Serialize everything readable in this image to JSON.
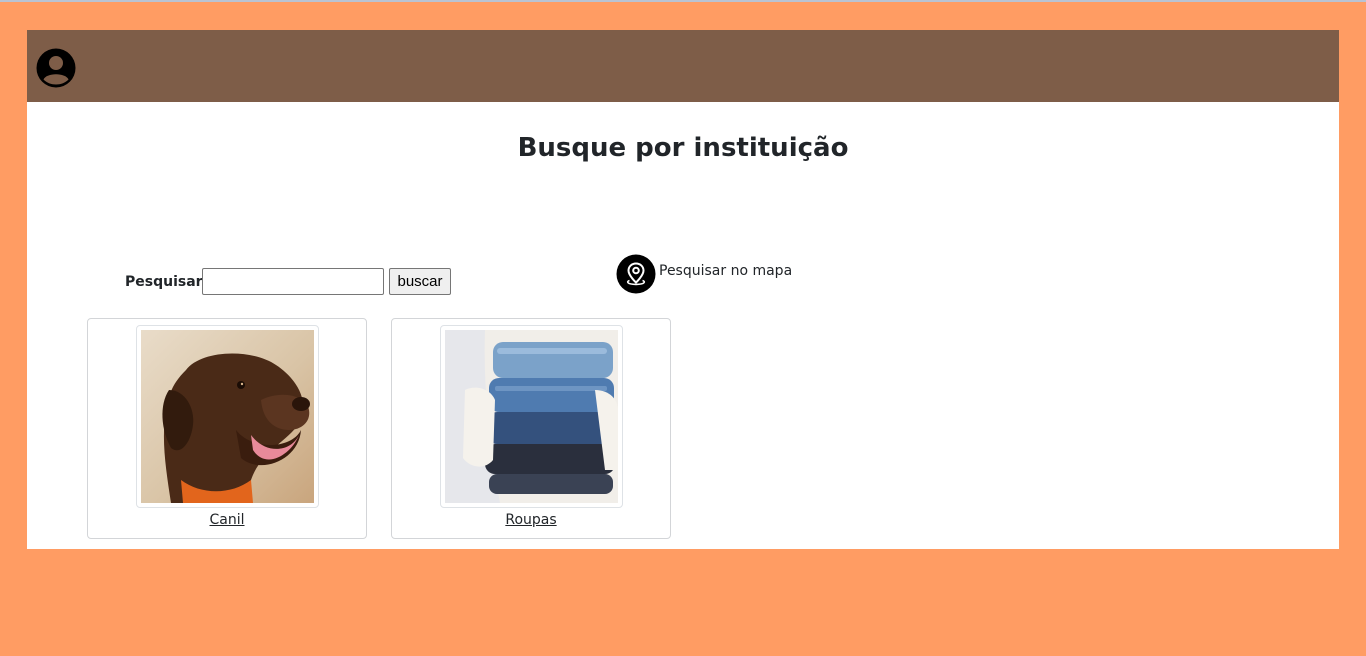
{
  "colors": {
    "page_background": "#ff9c63",
    "header_background": "#7e5d48",
    "content_background": "#ffffff"
  },
  "header": {
    "user_icon": "user-circle-icon"
  },
  "main": {
    "title": "Busque por instituição",
    "search": {
      "label": "Pesquisar:",
      "value": "",
      "placeholder": "",
      "button_label": "buscar"
    },
    "map_search": {
      "icon": "map-pin-icon",
      "label": "Pesquisar no mapa"
    },
    "cards": [
      {
        "image": "dog-photo",
        "label": "Canil"
      },
      {
        "image": "clothes-stack-photo",
        "label": "Roupas"
      }
    ]
  }
}
